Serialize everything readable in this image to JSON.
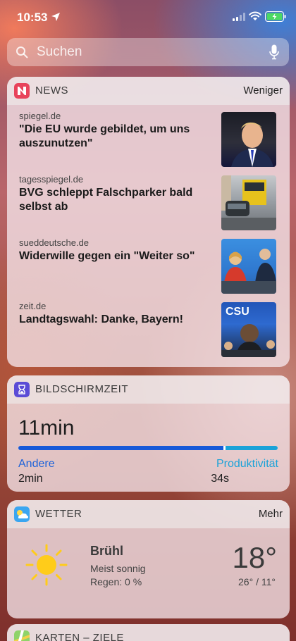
{
  "status_bar": {
    "time": "10:53"
  },
  "search": {
    "placeholder": "Suchen"
  },
  "news": {
    "title": "NEWS",
    "action": "Weniger",
    "items": [
      {
        "source": "spiegel.de",
        "headline": "\"Die EU wurde gebildet, um uns auszunutzen\""
      },
      {
        "source": "tagesspiegel.de",
        "headline": "BVG schleppt Falschparker bald selbst ab"
      },
      {
        "source": "sueddeutsche.de",
        "headline": "Widerwille gegen ein \"Weiter so\""
      },
      {
        "source": "zeit.de",
        "headline": "Landtagswahl: Danke, Bayern!"
      }
    ]
  },
  "screentime": {
    "title": "BILDSCHIRMZEIT",
    "total": "11min",
    "categories": [
      {
        "label": "Andere",
        "value": "2min",
        "share": 0.79
      },
      {
        "label": "Produktivität",
        "value": "34s",
        "share": 0.21
      }
    ]
  },
  "weather": {
    "title": "WETTER",
    "action": "Mehr",
    "city": "Brühl",
    "condition": "Meist sonnig",
    "rain": "Regen: 0 %",
    "temperature": "18°",
    "range": "26° / 11°"
  },
  "maps": {
    "title": "KARTEN – ZIELE"
  },
  "colors": {
    "screentime_primary": "#1759d8",
    "screentime_secondary": "#1ba2d8",
    "news_icon": "#e8425a",
    "screentime_icon": "#5b4bd6",
    "weather_icon": "#3aa6f0"
  }
}
